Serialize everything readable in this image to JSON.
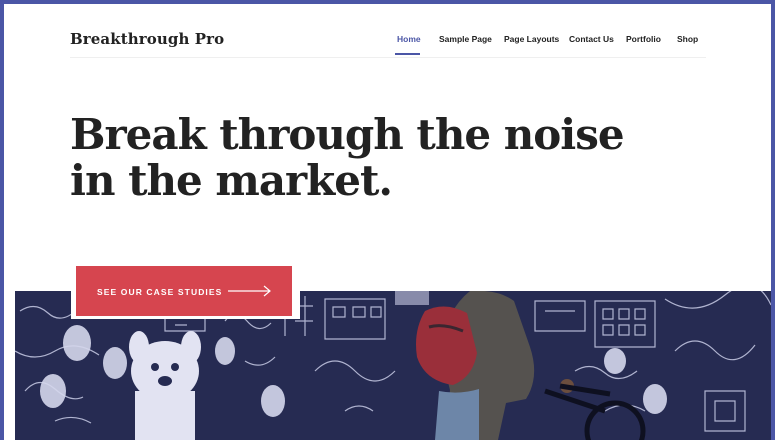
{
  "site": {
    "title": "Breakthrough Pro"
  },
  "nav": {
    "items": [
      {
        "label": "Home",
        "active": true
      },
      {
        "label": "Sample Page",
        "active": false
      },
      {
        "label": "Page Layouts",
        "active": false
      },
      {
        "label": "Contact Us",
        "active": false
      },
      {
        "label": "Portfolio",
        "active": false
      },
      {
        "label": "Shop",
        "active": false
      }
    ]
  },
  "hero": {
    "title_line1": "Break through the noise",
    "title_line2": "in the market.",
    "cta_label": "SEE OUR CASE STUDIES",
    "cta_icon": "arrow-right-icon"
  },
  "colors": {
    "accent": "#4b56a6",
    "cta": "#d6454f",
    "text": "#222222",
    "image_tint": "#262b52"
  }
}
